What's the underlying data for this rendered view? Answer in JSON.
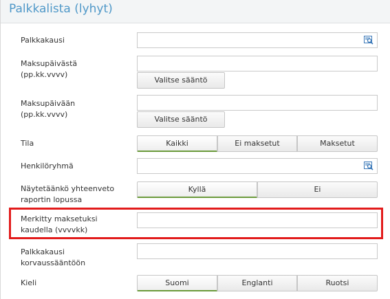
{
  "header": {
    "title": "Palkkalista (lyhyt)"
  },
  "form": {
    "palkkakausi": {
      "label": "Palkkakausi",
      "value": "",
      "icon": "lookup-icon"
    },
    "maksupaiva_from": {
      "label_line1": "Maksupäivästä",
      "label_line2": "(pp.kk.vvvv)",
      "value": "",
      "rule_button": "Valitse sääntö"
    },
    "maksupaiva_to": {
      "label_line1": "Maksupäivään",
      "label_line2": "(pp.kk.vvvv)",
      "value": "",
      "rule_button": "Valitse sääntö"
    },
    "tila": {
      "label": "Tila",
      "options": [
        "Kaikki",
        "Ei maksetut",
        "Maksetut"
      ],
      "selected": "Kaikki"
    },
    "henkiloryhma": {
      "label": "Henkilöryhmä",
      "value": "",
      "icon": "lookup-icon"
    },
    "yhteenveto": {
      "label_line1": "Näytetäänkö yhteenveto",
      "label_line2": "raportin lopussa",
      "options": [
        "Kyllä",
        "Ei"
      ],
      "selected": "Kyllä"
    },
    "merkitty": {
      "label_line1": "Merkitty maksetuksi",
      "label_line2": "kaudella (vvvvkk)",
      "value": "",
      "highlight_color": "#e21b1b"
    },
    "korvaussaanto": {
      "label_line1": "Palkkakausi",
      "label_line2": "korvaussääntöön",
      "value": ""
    },
    "kieli": {
      "label": "Kieli",
      "options": [
        "Suomi",
        "Englanti",
        "Ruotsi"
      ],
      "selected": "Suomi"
    }
  },
  "colors": {
    "title": "#4f98c8",
    "selected_underline": "#6a9a3a",
    "highlight": "#e21b1b",
    "icon": "#3a78b8"
  }
}
